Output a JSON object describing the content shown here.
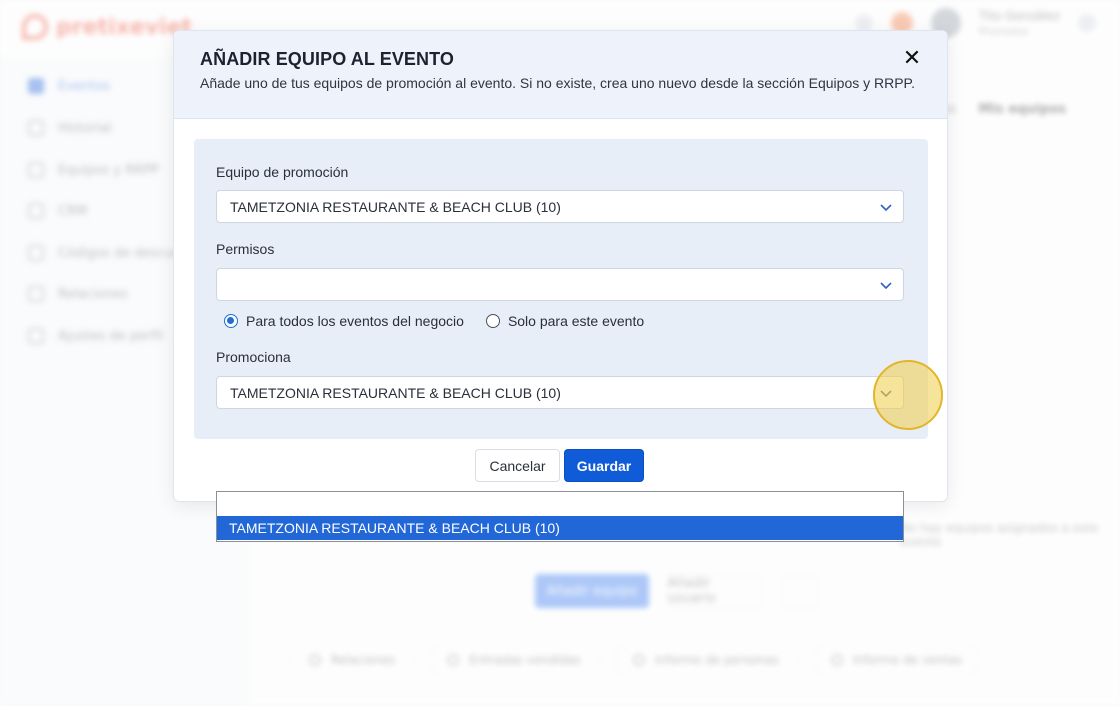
{
  "background": {
    "logo_text": "pretixeviet",
    "user_name": "Tito González",
    "user_subtitle": "Promotor",
    "nav_items": [
      {
        "label": "Eventos",
        "active": true
      },
      {
        "label": "Historial",
        "active": false
      },
      {
        "label": "Equipos y RRPP",
        "active": false
      },
      {
        "label": "CRM",
        "active": false
      },
      {
        "label": "Códigos de descuento",
        "active": false
      },
      {
        "label": "Relaciones",
        "active": false
      },
      {
        "label": "Ajustes de perfil",
        "active": false
      }
    ],
    "breadcrumb": {
      "prev": "Eventos",
      "current": "Mis equipos"
    },
    "hint": "No hay equipos asignados a este evento",
    "primary_button": "Añadir equipo",
    "ghost_button": "Añadir usuario",
    "tabs": [
      "Relaciones",
      "Entradas vendidas",
      "Informe de personas",
      "Informe de ventas"
    ]
  },
  "modal": {
    "title": "AÑADIR EQUIPO AL EVENTO",
    "subtitle": "Añade uno de tus equipos de promoción al evento. Si no existe, crea uno nuevo desde la sección Equipos y RRPP.",
    "close_glyph": "✕",
    "fields": {
      "team": {
        "label": "Equipo de promoción",
        "value": "TAMETZONIA RESTAURANTE & BEACH CLUB (10)"
      },
      "permissions": {
        "label": "Permisos",
        "value": ""
      },
      "promotes": {
        "label": "Promociona",
        "value": "TAMETZONIA RESTAURANTE & BEACH CLUB (10)"
      }
    },
    "radio_options": [
      {
        "label": "Para todos los eventos del negocio",
        "checked": true
      },
      {
        "label": "Solo para este evento",
        "checked": false
      }
    ],
    "cancel_label": "Cancelar",
    "save_label": "Guardar"
  },
  "dropdown": {
    "options": [
      "",
      "TAMETZONIA RESTAURANTE & BEACH CLUB (10)"
    ],
    "selected_index": 1
  },
  "colors": {
    "primary": "#0f5bd8",
    "selected_option": "#2267d8",
    "highlight": "#f1ce48",
    "header_bg": "#eef3fb",
    "panel_bg": "#e8eef7"
  }
}
